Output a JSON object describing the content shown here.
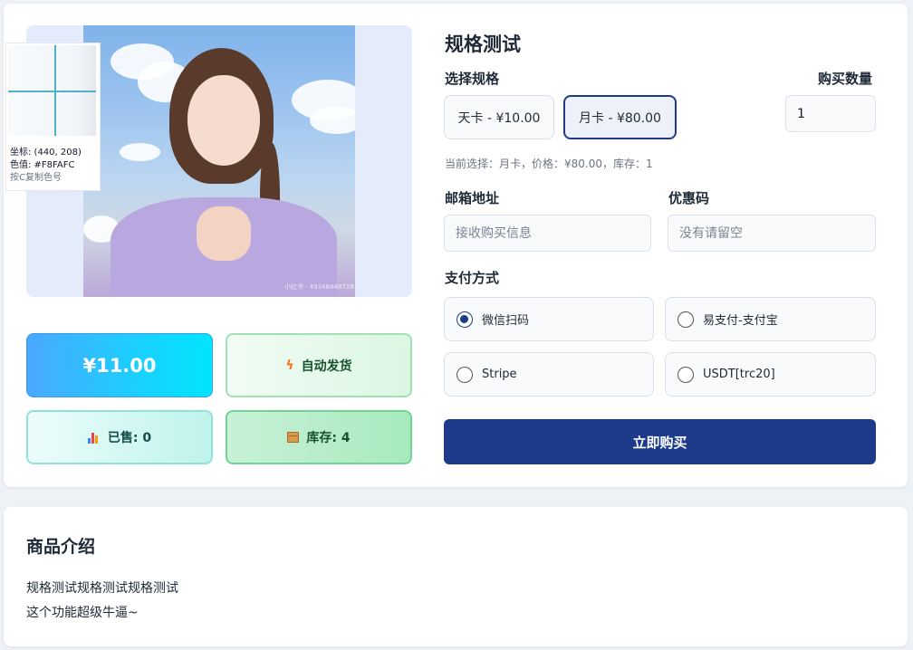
{
  "product": {
    "title": "规格测试",
    "photo_watermark": "小红书 · 49348448728"
  },
  "color_picker": {
    "coords_text": "坐标: (440, 208)",
    "color_text": "色值: #F8FAFC",
    "hint_text": "按C复制色号"
  },
  "stats": {
    "price": "¥11.00",
    "delivery": "自动发货",
    "sold": "已售: 0",
    "stock": "库存: 4",
    "icons": {
      "delivery": "lightning-icon",
      "sold": "bar-chart-icon",
      "stock": "package-icon"
    }
  },
  "spec": {
    "label": "选择规格",
    "options": [
      {
        "label": "天卡 - ¥10.00",
        "selected": false
      },
      {
        "label": "月卡 - ¥80.00",
        "selected": true
      }
    ],
    "current": "当前选择：月卡，价格：¥80.00，库存：1"
  },
  "quantity": {
    "label": "购买数量",
    "value": "1"
  },
  "email": {
    "label": "邮箱地址",
    "placeholder": "接收购买信息"
  },
  "coupon": {
    "label": "优惠码",
    "placeholder": "没有请留空"
  },
  "payment": {
    "label": "支付方式",
    "methods": [
      {
        "label": "微信扫码",
        "selected": true
      },
      {
        "label": "易支付-支付宝",
        "selected": false
      },
      {
        "label": "Stripe",
        "selected": false
      },
      {
        "label": "USDT[trc20]",
        "selected": false
      }
    ]
  },
  "buy_button": "立即购买",
  "intro": {
    "title": "商品介绍",
    "lines": [
      "规格测试规格测试规格测试",
      "这个功能超级牛逼~"
    ]
  },
  "colors": {
    "primary": "#1E3A8A",
    "price_gradient_start": "#4AA8FF",
    "price_gradient_end": "#00E5FF",
    "success_border": "#6FD495",
    "page_bg": "#EEF1F5"
  }
}
